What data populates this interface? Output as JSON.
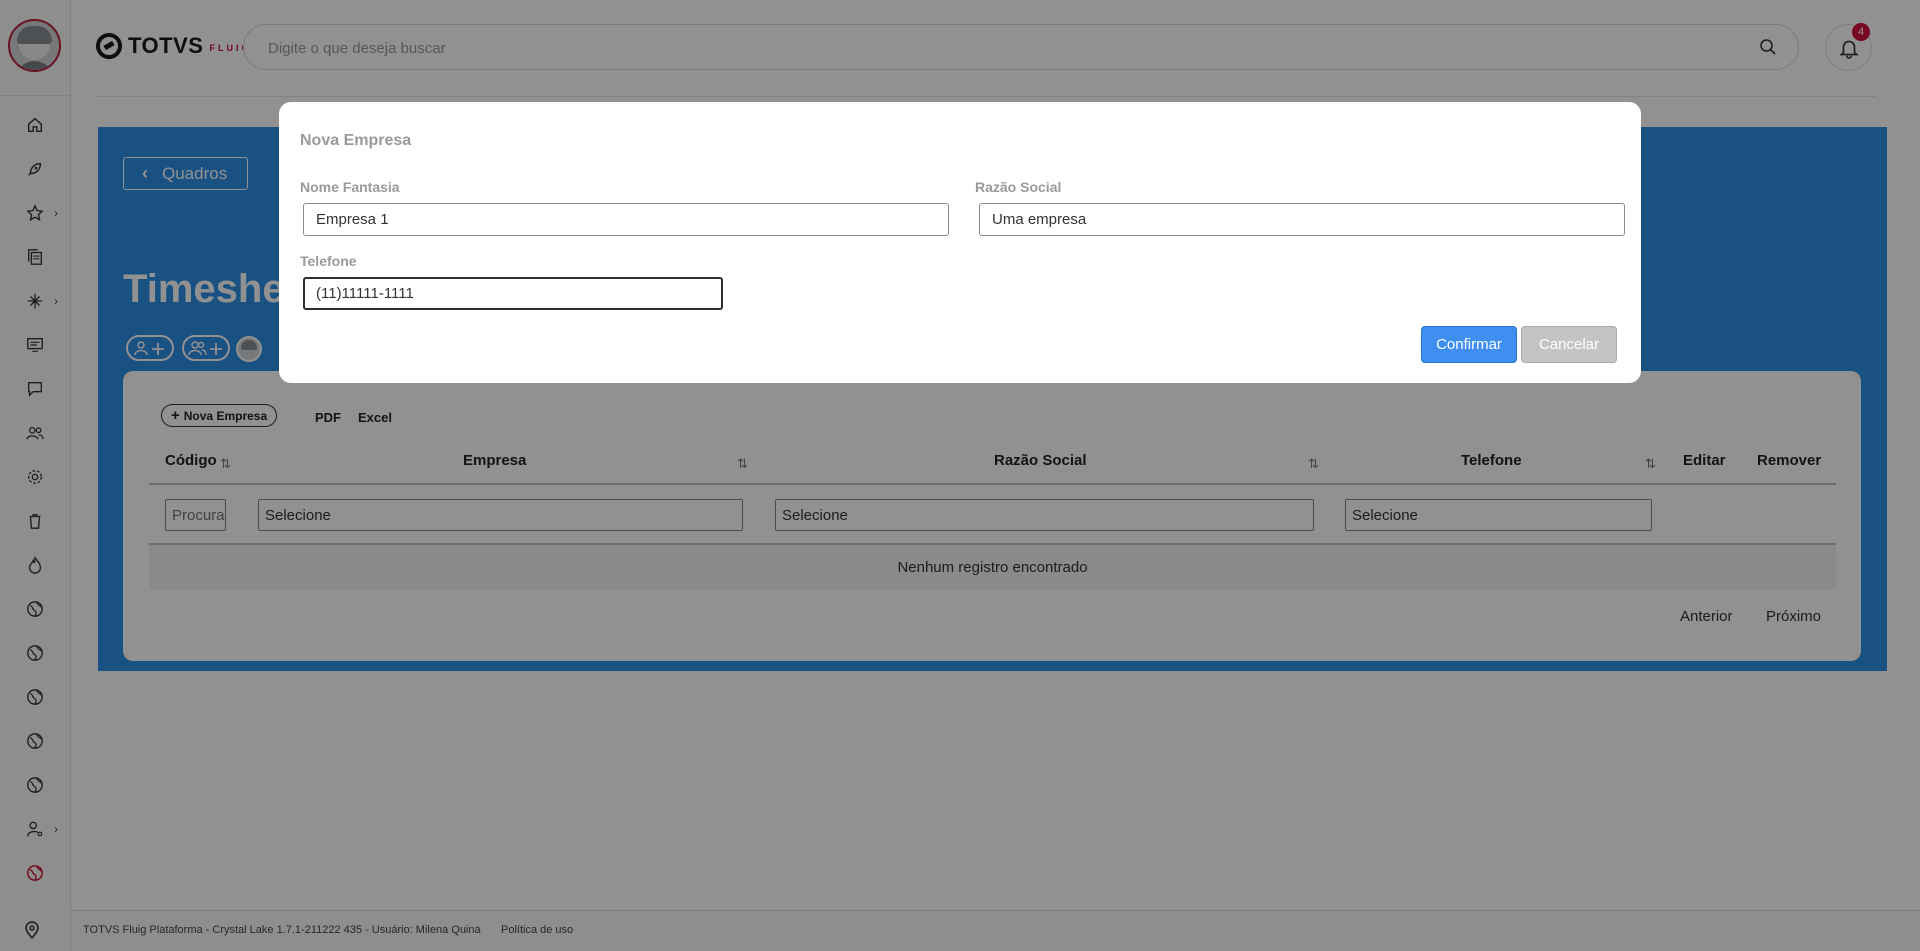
{
  "topbar": {
    "brand_name": "TOTVS",
    "brand_sub": "FLUIG",
    "search_placeholder": "Digite o que deseja buscar",
    "notification_count": "4"
  },
  "sidebar": {
    "icons": [
      "home-icon",
      "rocket-icon",
      "star-icon",
      "documents-icon",
      "workflow-icon",
      "monitor-icon",
      "chat-icon",
      "people-icon",
      "gear-icon",
      "trash-icon",
      "flame-icon",
      "globe-icon",
      "globe-icon",
      "globe-icon",
      "globe-icon",
      "globe-icon",
      "user-settings-icon",
      "globe-icon",
      "pin-icon"
    ]
  },
  "page": {
    "back_label": "Quadros",
    "title": "Timeshee"
  },
  "toolbar": {
    "new_company_label": "Nova Empresa",
    "pdf_label": "PDF",
    "excel_label": "Excel"
  },
  "table": {
    "headers": {
      "codigo": "Código",
      "empresa": "Empresa",
      "razao_social": "Razão Social",
      "telefone": "Telefone",
      "editar": "Editar",
      "remover": "Remover"
    },
    "filters": {
      "codigo_placeholder": "Procurar",
      "empresa_value": "Selecione",
      "razao_value": "Selecione",
      "telefone_value": "Selecione"
    },
    "empty_message": "Nenhum registro encontrado",
    "pager": {
      "previous": "Anterior",
      "next": "Próximo"
    }
  },
  "modal": {
    "title": "Nova Empresa",
    "fields": {
      "nome_fantasia_label": "Nome Fantasia",
      "nome_fantasia_value": "Empresa 1",
      "razao_social_label": "Razão Social",
      "razao_social_value": "Uma empresa",
      "telefone_label": "Telefone",
      "telefone_value": "(11)11111-1111"
    },
    "confirm_label": "Confirmar",
    "cancel_label": "Cancelar"
  },
  "footer": {
    "text": "TOTVS Fluig Plataforma - Crystal Lake 1.7.1-211222 435 - Usuário: Milena Quina",
    "policy_link": "Política de uso"
  },
  "colors": {
    "accent_blue": "#2f8fe6",
    "confirm_blue": "#3f8ff0",
    "brand_red": "#c8102e"
  }
}
